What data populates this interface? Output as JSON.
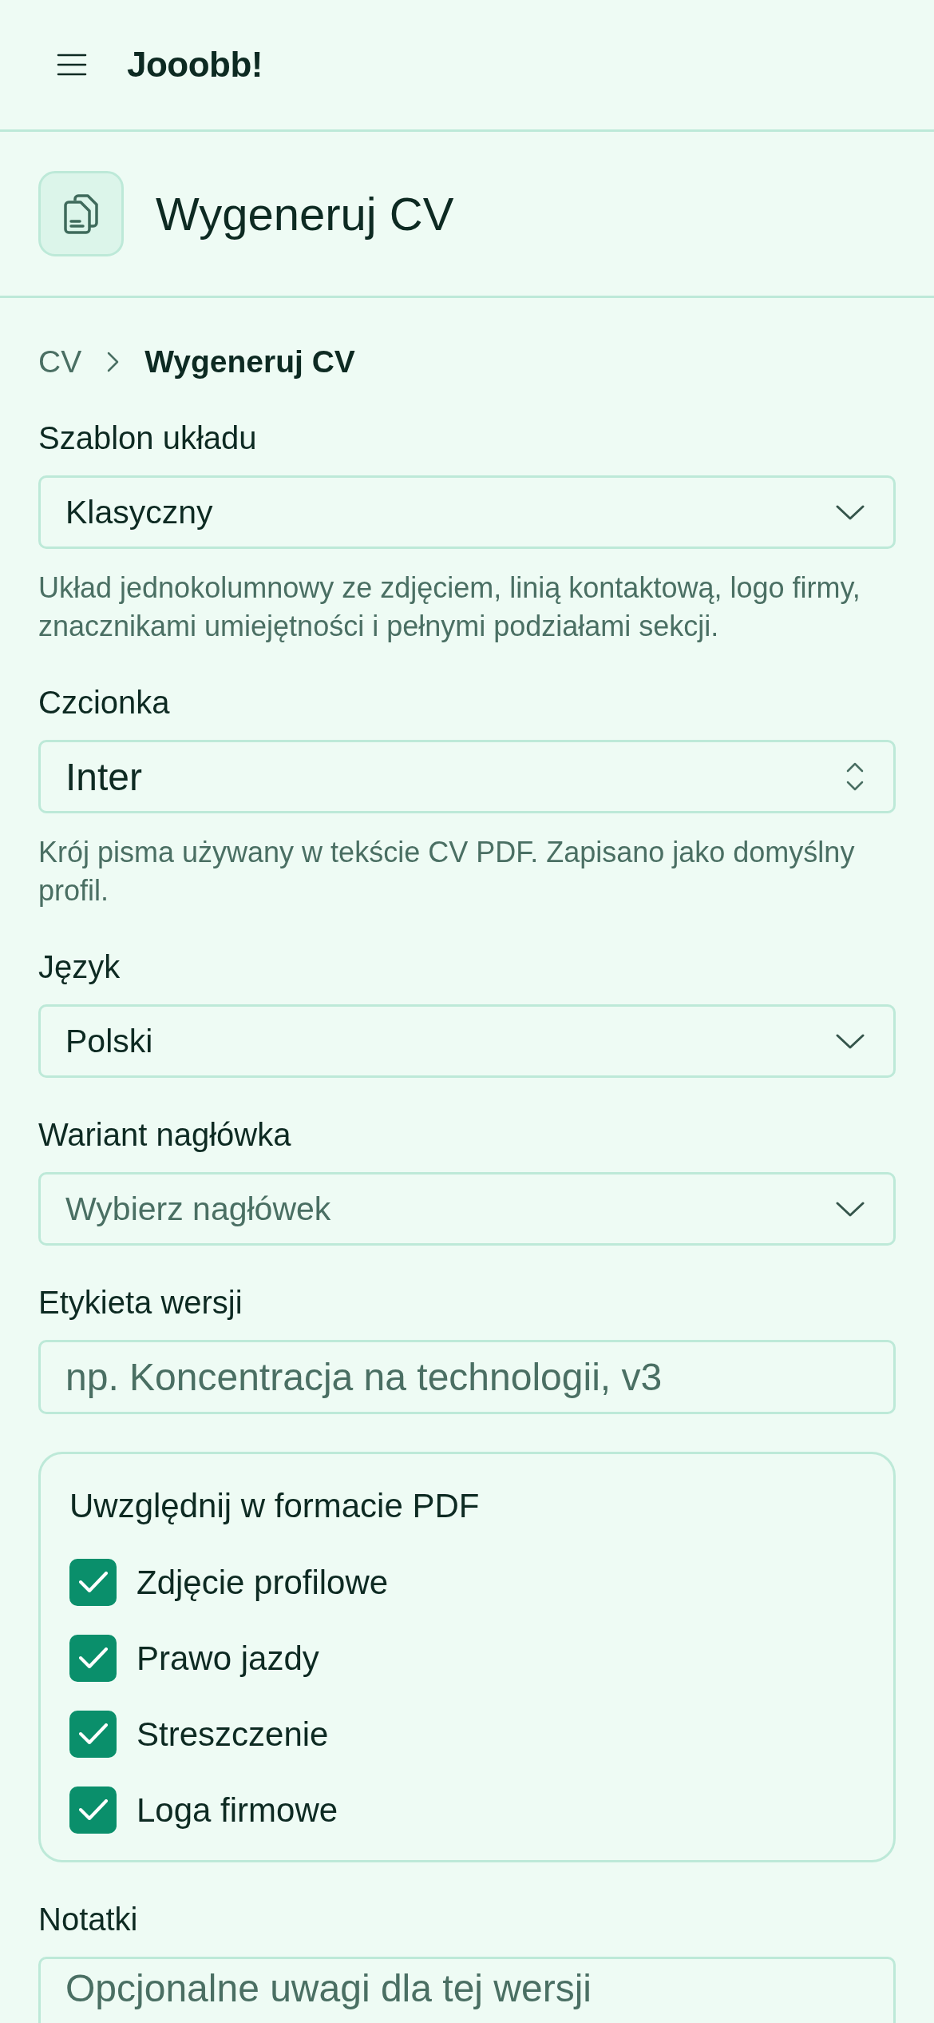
{
  "header": {
    "app_name": "Jooobb!"
  },
  "page_header": {
    "title": "Wygeneruj CV"
  },
  "breadcrumb": [
    {
      "label": "CV",
      "current": false
    },
    {
      "label": "Wygeneruj CV",
      "current": true
    }
  ],
  "form": [
    {
      "kind": "select",
      "label": "Szablon układu",
      "value": "Klasyczny",
      "help": "Układ jednokolumnowy ze zdjęciem, linią kontaktową, logo firmy, znacznikami umiejętności i pełnymi podziałami sekcji."
    },
    {
      "kind": "combo",
      "label": "Czcionka",
      "value": "Inter",
      "help": "Krój pisma używany w tekście CV PDF. Zapisano jako domyślny profil."
    },
    {
      "kind": "select",
      "label": "Język",
      "value": "Polski"
    },
    {
      "kind": "select",
      "label": "Wariant nagłówka",
      "placeholder": "Wybierz nagłówek"
    },
    {
      "kind": "input",
      "label": "Etykieta wersji",
      "placeholder": "np. Koncentracja na technologii, v3"
    },
    {
      "kind": "checkbox-group",
      "title": "Uwzględnij w formacie PDF",
      "options": [
        {
          "label": "Zdjęcie profilowe",
          "checked": true
        },
        {
          "label": "Prawo jazdy",
          "checked": true
        },
        {
          "label": "Streszczenie",
          "checked": true
        },
        {
          "label": "Loga firmowe",
          "checked": true
        }
      ]
    },
    {
      "kind": "textarea",
      "label": "Notatki",
      "placeholder": "Opcjonalne uwagi dla tej wersji"
    }
  ]
}
